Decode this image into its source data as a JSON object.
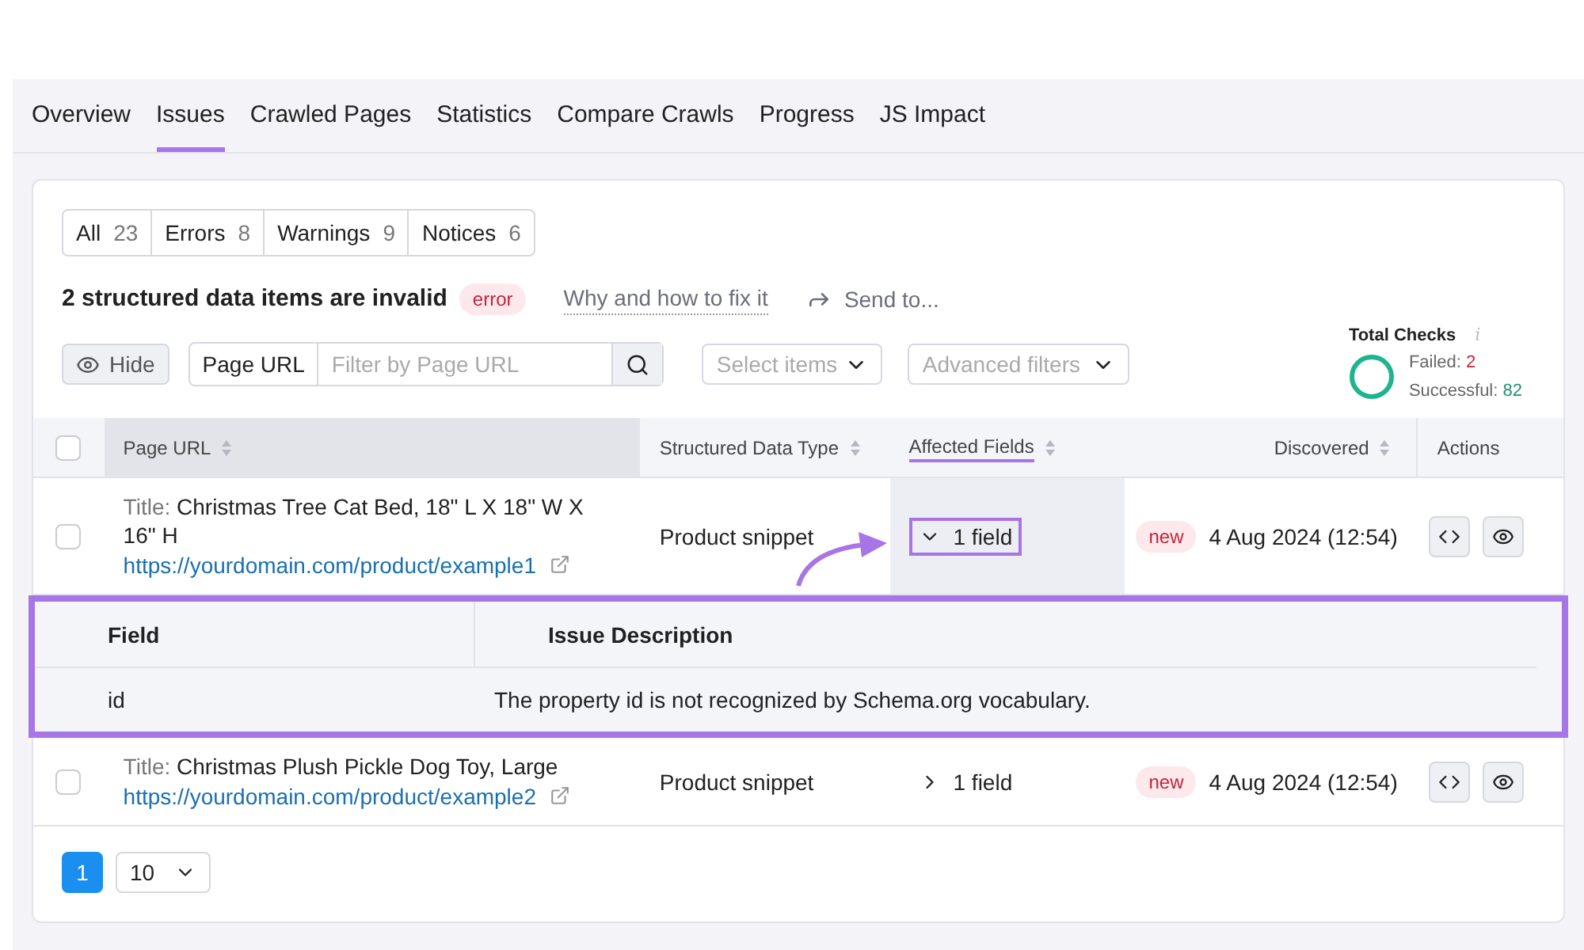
{
  "tabs": [
    {
      "label": "Overview",
      "selected": false
    },
    {
      "label": "Issues",
      "selected": true
    },
    {
      "label": "Crawled Pages",
      "selected": false
    },
    {
      "label": "Statistics",
      "selected": false
    },
    {
      "label": "Compare Crawls",
      "selected": false
    },
    {
      "label": "Progress",
      "selected": false
    },
    {
      "label": "JS Impact",
      "selected": false
    }
  ],
  "filters": [
    {
      "label": "All",
      "count": "23"
    },
    {
      "label": "Errors",
      "count": "8"
    },
    {
      "label": "Warnings",
      "count": "9"
    },
    {
      "label": "Notices",
      "count": "6"
    }
  ],
  "issue": {
    "title": "2 structured data items are invalid",
    "badge": "error",
    "help_link": "Why and how to fix it",
    "send": "Send to..."
  },
  "toolbar": {
    "hide": "Hide",
    "search_label": "Page URL",
    "search_placeholder": "Filter by Page URL",
    "select": "Select items",
    "advanced": "Advanced filters"
  },
  "total_checks": {
    "title": "Total Checks",
    "info": "i",
    "failed_label": "Failed:",
    "failed": "2",
    "successful_label": "Successful:",
    "successful": "82"
  },
  "table": {
    "select_all_checked": false,
    "columns": [
      {
        "label": "Page URL",
        "sortable": true,
        "selected": true
      },
      {
        "label": "Structured Data Type",
        "sortable": true,
        "selected": false
      },
      {
        "label": "Affected Fields",
        "sortable": true,
        "selected": false
      },
      {
        "label": "Discovered",
        "sortable": true,
        "selected": false
      },
      {
        "label": "Actions",
        "sortable": false,
        "selected": false
      }
    ],
    "rows": [
      {
        "checked": false,
        "title_label": "Title:",
        "title": "Christmas Tree Cat Bed, 18\" L X 18\" W X 16\" H",
        "url": "https://yourdomain.com/product/example1",
        "type": "Product snippet",
        "fields": "1 field",
        "expanded": true,
        "badge": "new",
        "discovered": "4 Aug 2024 (12:54)",
        "details": {
          "columns": [
            "Field",
            "Issue Description"
          ],
          "rows": [
            [
              "id",
              "The property id is not recognized by Schema.org vocabulary."
            ]
          ]
        }
      },
      {
        "checked": false,
        "title_label": "Title:",
        "title": "Christmas Plush Pickle Dog Toy, Large",
        "url": "https://yourdomain.com/product/example2",
        "type": "Product snippet",
        "fields": "1 field",
        "expanded": false,
        "badge": "new",
        "discovered": "4 Aug 2024 (12:54)"
      }
    ]
  },
  "pagination": {
    "pages": [
      {
        "label": "1",
        "selected": true
      }
    ],
    "per_page": "10"
  }
}
